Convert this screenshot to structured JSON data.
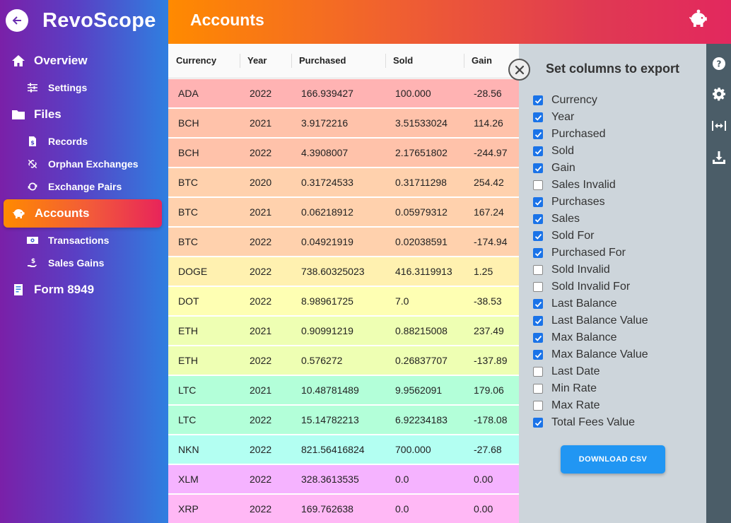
{
  "app": {
    "title": "RevoScope"
  },
  "sidebar": {
    "items": [
      {
        "label": "Overview",
        "icon": "home-icon",
        "level": "main"
      },
      {
        "label": "Settings",
        "icon": "sliders-icon",
        "level": "sub"
      },
      {
        "label": "Files",
        "icon": "folder-icon",
        "level": "main"
      },
      {
        "label": "Records",
        "icon": "dollar-file-icon",
        "level": "sub"
      },
      {
        "label": "Orphan Exchanges",
        "icon": "unlink-icon",
        "level": "sub"
      },
      {
        "label": "Exchange Pairs",
        "icon": "sync-icon",
        "level": "sub"
      },
      {
        "label": "Accounts",
        "icon": "piggy-bank-icon",
        "level": "main",
        "active": true
      },
      {
        "label": "Transactions",
        "icon": "money-bill-icon",
        "level": "sub"
      },
      {
        "label": "Sales Gains",
        "icon": "hand-dollar-icon",
        "level": "sub"
      },
      {
        "label": "Form 8949",
        "icon": "tax-form-icon",
        "level": "main"
      }
    ]
  },
  "header": {
    "title": "Accounts"
  },
  "table": {
    "columns": [
      "Currency",
      "Year",
      "Purchased",
      "Sold",
      "Gain"
    ],
    "rows": [
      {
        "currency": "ADA",
        "year": "2022",
        "purchased": "166.939427",
        "sold": "100.000",
        "gain": "-28.56",
        "color": "#ffb3b3"
      },
      {
        "currency": "BCH",
        "year": "2021",
        "purchased": "3.9172216",
        "sold": "3.51533024",
        "gain": "114.26",
        "color": "#ffc2aa"
      },
      {
        "currency": "BCH",
        "year": "2022",
        "purchased": "4.3908007",
        "sold": "2.17651802",
        "gain": "-244.97",
        "color": "#ffc2aa"
      },
      {
        "currency": "BTC",
        "year": "2020",
        "purchased": "0.31724533",
        "sold": "0.31711298",
        "gain": "254.42",
        "color": "#ffd1ad"
      },
      {
        "currency": "BTC",
        "year": "2021",
        "purchased": "0.06218912",
        "sold": "0.05979312",
        "gain": "167.24",
        "color": "#ffd1ad"
      },
      {
        "currency": "BTC",
        "year": "2022",
        "purchased": "0.04921919",
        "sold": "0.02038591",
        "gain": "-174.94",
        "color": "#ffd1ad"
      },
      {
        "currency": "DOGE",
        "year": "2022",
        "purchased": "738.60325023",
        "sold": "416.3119913",
        "gain": "1.25",
        "color": "#fff1b0"
      },
      {
        "currency": "DOT",
        "year": "2022",
        "purchased": "8.98961725",
        "sold": "7.0",
        "gain": "-38.53",
        "color": "#feffb3"
      },
      {
        "currency": "ETH",
        "year": "2021",
        "purchased": "0.90991219",
        "sold": "0.88215008",
        "gain": "237.49",
        "color": "#eeffb3"
      },
      {
        "currency": "ETH",
        "year": "2022",
        "purchased": "0.576272",
        "sold": "0.26837707",
        "gain": "-137.89",
        "color": "#eeffb3"
      },
      {
        "currency": "LTC",
        "year": "2021",
        "purchased": "10.48781489",
        "sold": "9.9562091",
        "gain": "179.06",
        "color": "#b3ffd9"
      },
      {
        "currency": "LTC",
        "year": "2022",
        "purchased": "15.14782213",
        "sold": "6.92234183",
        "gain": "-178.08",
        "color": "#b3ffd9"
      },
      {
        "currency": "NKN",
        "year": "2022",
        "purchased": "821.56416824",
        "sold": "700.000",
        "gain": "-27.68",
        "color": "#b3fff2"
      },
      {
        "currency": "XLM",
        "year": "2022",
        "purchased": "328.3613535",
        "sold": "0.0",
        "gain": "0.00",
        "color": "#f5b3ff"
      },
      {
        "currency": "XRP",
        "year": "2022",
        "purchased": "169.762638",
        "sold": "0.0",
        "gain": "0.00",
        "color": "#ffb8f5"
      }
    ]
  },
  "export_panel": {
    "title": "Set columns to export",
    "options": [
      {
        "label": "Currency",
        "checked": true
      },
      {
        "label": "Year",
        "checked": true
      },
      {
        "label": "Purchased",
        "checked": true
      },
      {
        "label": "Sold",
        "checked": true
      },
      {
        "label": "Gain",
        "checked": true
      },
      {
        "label": "Sales Invalid",
        "checked": false
      },
      {
        "label": "Purchases",
        "checked": true
      },
      {
        "label": "Sales",
        "checked": true
      },
      {
        "label": "Sold For",
        "checked": true
      },
      {
        "label": "Purchased For",
        "checked": true
      },
      {
        "label": "Sold Invalid",
        "checked": false
      },
      {
        "label": "Sold Invalid For",
        "checked": false
      },
      {
        "label": "Last Balance",
        "checked": true
      },
      {
        "label": "Last Balance Value",
        "checked": true
      },
      {
        "label": "Max Balance",
        "checked": true
      },
      {
        "label": "Max Balance Value",
        "checked": true
      },
      {
        "label": "Last Date",
        "checked": false
      },
      {
        "label": "Min Rate",
        "checked": false
      },
      {
        "label": "Max Rate",
        "checked": false
      },
      {
        "label": "Total Fees Value",
        "checked": true
      }
    ],
    "download_label": "DOWNLOAD CSV"
  },
  "toolbar": {
    "icons": [
      "help-icon",
      "gear-icon",
      "fit-width-icon",
      "download-icon"
    ]
  },
  "colors": {
    "accent": "#2196f3",
    "checkbox": "#1a73e8",
    "toolbar": "#4b5d68",
    "panel": "#cdd5db"
  }
}
